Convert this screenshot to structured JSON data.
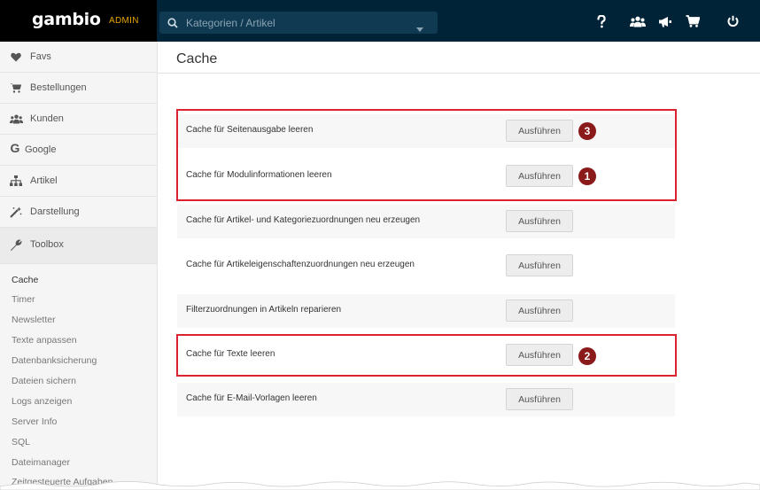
{
  "brand": {
    "logo": "gambio",
    "tag": "ADMIN"
  },
  "search": {
    "placeholder": "Kategorien / Artikel"
  },
  "topbar_icons": [
    "help-icon",
    "users-icon",
    "megaphone-icon",
    "cart-icon",
    "power-icon"
  ],
  "sidebar": {
    "items": [
      {
        "label": "Favs",
        "icon": "heart-icon"
      },
      {
        "label": "Bestellungen",
        "icon": "cart-icon"
      },
      {
        "label": "Kunden",
        "icon": "users-icon"
      },
      {
        "label": "Google",
        "icon": "google-icon"
      },
      {
        "label": "Artikel",
        "icon": "sitemap-icon"
      },
      {
        "label": "Darstellung",
        "icon": "magic-wand-icon"
      },
      {
        "label": "Toolbox",
        "icon": "wrench-icon"
      }
    ],
    "sub_items": [
      "Cache",
      "Timer",
      "Newsletter",
      "Texte anpassen",
      "Datenbanksicherung",
      "Dateien sichern",
      "Logs anzeigen",
      "Server Info",
      "SQL",
      "Dateimanager",
      "Zeitgesteuerte Aufgaben"
    ],
    "active_sub": "Cache"
  },
  "page": {
    "title": "Cache"
  },
  "rows": [
    {
      "label": "Cache für Seitenausgabe leeren",
      "button": "Ausführen",
      "badge": "3"
    },
    {
      "label": "Cache für Modulinformationen leeren",
      "button": "Ausführen",
      "badge": "1"
    },
    {
      "label": "Cache für Artikel- und Kategoriezuordnungen neu erzeugen",
      "button": "Ausführen"
    },
    {
      "label": "Cache für Artikeleigenschaftenzuordnungen neu erzeugen",
      "button": "Ausführen"
    },
    {
      "label": "Filterzuordnungen in Artikeln reparieren",
      "button": "Ausführen"
    },
    {
      "label": "Cache für Texte leeren",
      "button": "Ausführen",
      "badge": "2"
    },
    {
      "label": "Cache für E-Mail-Vorlagen leeren",
      "button": "Ausführen"
    }
  ],
  "colors": {
    "topbar": "#002337",
    "admin_tag": "#e8a400",
    "highlight": "#d9232f",
    "badge": "#8b1a1a"
  }
}
